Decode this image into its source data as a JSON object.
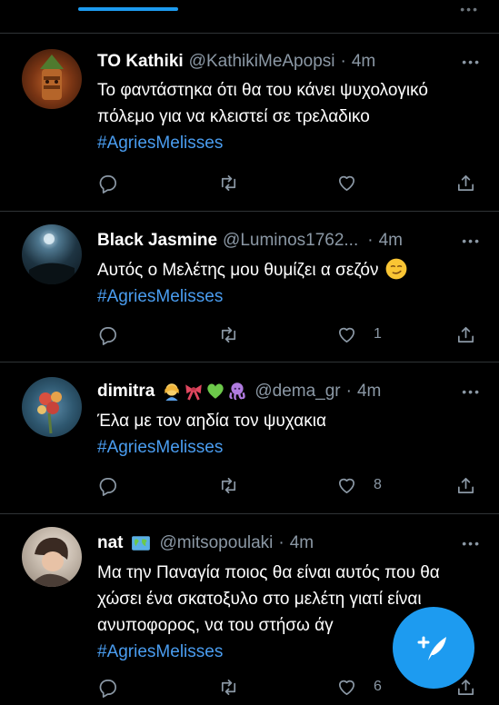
{
  "tweets": [
    {
      "name": "ΤΟ Kathiki",
      "handle": "@KathikiMeApopsi",
      "time": "4m",
      "text": "Το φαντάστηκα ότι θα του κάνει ψυχολογικό πόλεμο για να κλειστεί σε τρελαδικο",
      "hashtag": "#AgriesMelisses",
      "likes": ""
    },
    {
      "name": "Black Jasmine",
      "handle": "@Luminos1762...",
      "time": "4m",
      "text": "Αυτός ο Μελέτης μου θυμίζει α σεζόν",
      "hashtag": "#AgriesMelisses",
      "likes": "1"
    },
    {
      "name": "dimitra",
      "handle": "@dema_gr",
      "time": "4m",
      "text": "Έλα με τον αηδία τον ψυχακια",
      "hashtag": "#AgriesMelisses",
      "likes": "8"
    },
    {
      "name": "nat",
      "handle": "@mitsopoulaki",
      "time": "4m",
      "text": "Μα την Παναγία ποιος θα είναι αυτός που θα χώσει ένα σκατοξυλο στο μελέτη γιατί είναι ανυποφορος, να του στήσω άγ",
      "hashtag": "#AgriesMelisses",
      "likes": "6"
    }
  ],
  "icons": {
    "reply": "reply-icon",
    "retweet": "retweet-icon",
    "like": "heart-icon",
    "share": "share-icon",
    "compose": "compose-tweet-icon"
  },
  "colors": {
    "background": "#000000",
    "accent": "#1d9bf0",
    "hashtag": "#4a9df0",
    "secondary_text": "#8b98a5"
  }
}
